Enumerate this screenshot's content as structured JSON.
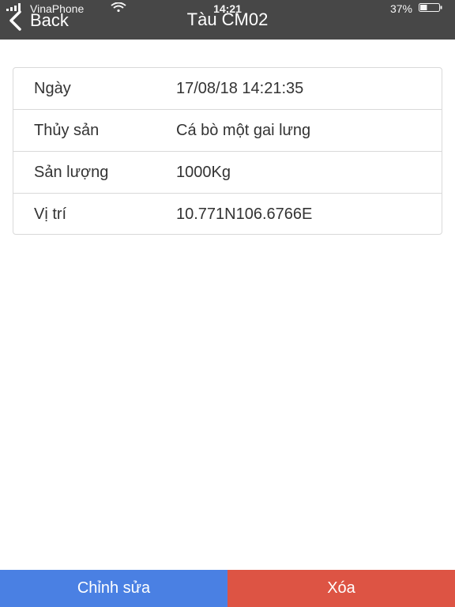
{
  "status_bar": {
    "carrier": "VinaPhone",
    "time": "14:21",
    "battery": "37%",
    "battery_level": 0.37
  },
  "nav": {
    "back_label": "Back",
    "title": "Tàu CM02"
  },
  "details": [
    {
      "label": "Ngày",
      "value": "17/08/18 14:21:35"
    },
    {
      "label": "Thủy sản",
      "value": "Cá bò một gai lưng"
    },
    {
      "label": "Sản lượng",
      "value": "1000Kg"
    },
    {
      "label": "Vị trí",
      "value": "10.771N106.6766E"
    }
  ],
  "actions": {
    "edit_label": "Chỉnh sửa",
    "delete_label": "Xóa"
  },
  "colors": {
    "header_bg": "#474747",
    "edit_button": "#4a80e3",
    "delete_button": "#dd5444",
    "border": "#d9d9d9"
  },
  "icons": {
    "back": "chevron-left-icon",
    "signal": "signal-bars-icon",
    "wifi": "wifi-icon",
    "battery": "battery-icon"
  }
}
